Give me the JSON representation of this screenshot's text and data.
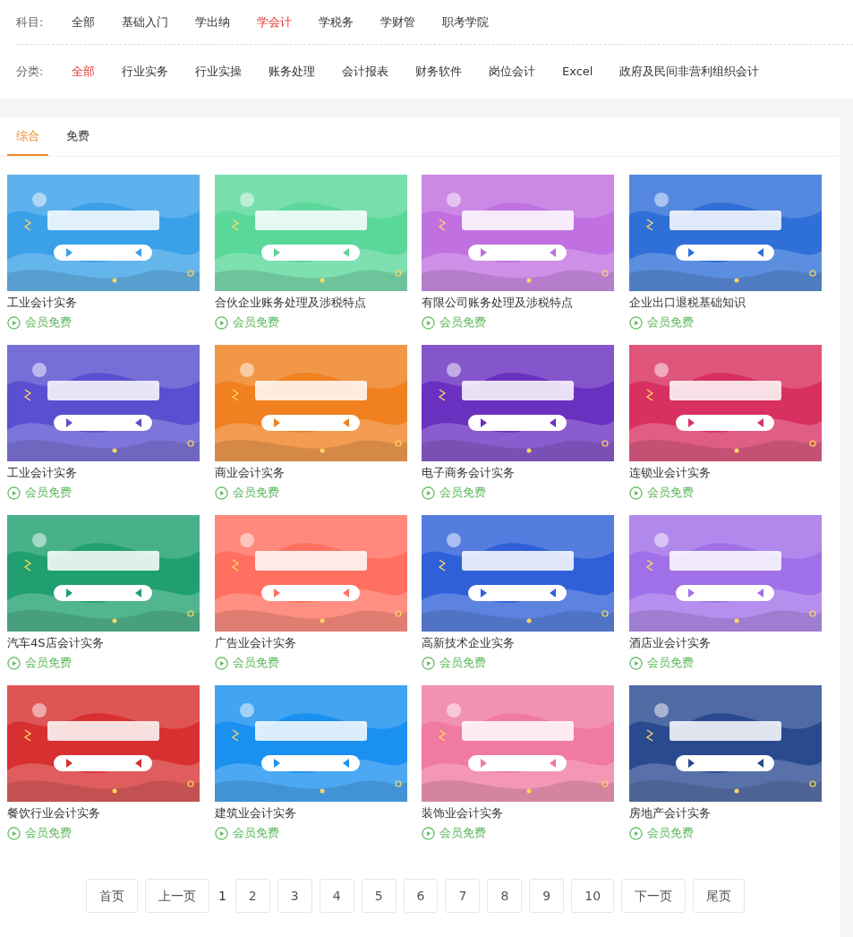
{
  "filters": [
    {
      "label": "科目:",
      "options": [
        {
          "text": "全部",
          "selected": false
        },
        {
          "text": "基础入门",
          "selected": false
        },
        {
          "text": "学出纳",
          "selected": false
        },
        {
          "text": "学会计",
          "selected": true
        },
        {
          "text": "学税务",
          "selected": false
        },
        {
          "text": "学财管",
          "selected": false
        },
        {
          "text": "职考学院",
          "selected": false
        }
      ]
    },
    {
      "label": "分类:",
      "options": [
        {
          "text": "全部",
          "selected": true
        },
        {
          "text": "行业实务",
          "selected": false
        },
        {
          "text": "行业实操",
          "selected": false
        },
        {
          "text": "账务处理",
          "selected": false
        },
        {
          "text": "会计报表",
          "selected": false
        },
        {
          "text": "财务软件",
          "selected": false
        },
        {
          "text": "岗位会计",
          "selected": false
        },
        {
          "text": "Excel",
          "selected": false
        },
        {
          "text": "政府及民间非营利组织会计",
          "selected": false
        }
      ]
    }
  ],
  "tabs": [
    {
      "label": "综合",
      "selected": true
    },
    {
      "label": "免费",
      "selected": false
    }
  ],
  "courses": [
    {
      "title": "工业会计实务",
      "price": "会员免费",
      "color": "#3aa0e8"
    },
    {
      "title": "合伙企业账务处理及涉税特点",
      "price": "会员免费",
      "color": "#5ad89a"
    },
    {
      "title": "有限公司账务处理及涉税特点",
      "price": "会员免费",
      "color": "#c070e0"
    },
    {
      "title": "企业出口退税基础知识",
      "price": "会员免费",
      "color": "#2f6fd8"
    },
    {
      "title": "工业会计实务",
      "price": "会员免费",
      "color": "#5a4fd0"
    },
    {
      "title": "商业会计实务",
      "price": "会员免费",
      "color": "#f08020"
    },
    {
      "title": "电子商务会计实务",
      "price": "会员免费",
      "color": "#6a30c0"
    },
    {
      "title": "连锁业会计实务",
      "price": "会员免费",
      "color": "#d83060"
    },
    {
      "title": "汽车4S店会计实务",
      "price": "会员免费",
      "color": "#20a070"
    },
    {
      "title": "广告业会计实务",
      "price": "会员免费",
      "color": "#ff7060"
    },
    {
      "title": "高新技术企业实务",
      "price": "会员免费",
      "color": "#3060d8"
    },
    {
      "title": "酒店业会计实务",
      "price": "会员免费",
      "color": "#a070e8"
    },
    {
      "title": "餐饮行业会计实务",
      "price": "会员免费",
      "color": "#d83030"
    },
    {
      "title": "建筑业会计实务",
      "price": "会员免费",
      "color": "#1a90f0"
    },
    {
      "title": "装饰业会计实务",
      "price": "会员免费",
      "color": "#f07aa0"
    },
    {
      "title": "房地产会计实务",
      "price": "会员免费",
      "color": "#2a4a90"
    }
  ],
  "pagination": [
    {
      "text": "首页",
      "selected": false
    },
    {
      "text": "上一页",
      "selected": false
    },
    {
      "text": "1",
      "selected": true
    },
    {
      "text": "2",
      "selected": false
    },
    {
      "text": "3",
      "selected": false
    },
    {
      "text": "4",
      "selected": false
    },
    {
      "text": "5",
      "selected": false
    },
    {
      "text": "6",
      "selected": false
    },
    {
      "text": "7",
      "selected": false
    },
    {
      "text": "8",
      "selected": false
    },
    {
      "text": "9",
      "selected": false
    },
    {
      "text": "10",
      "selected": false
    },
    {
      "text": "下一页",
      "selected": false
    },
    {
      "text": "尾页",
      "selected": false
    }
  ]
}
